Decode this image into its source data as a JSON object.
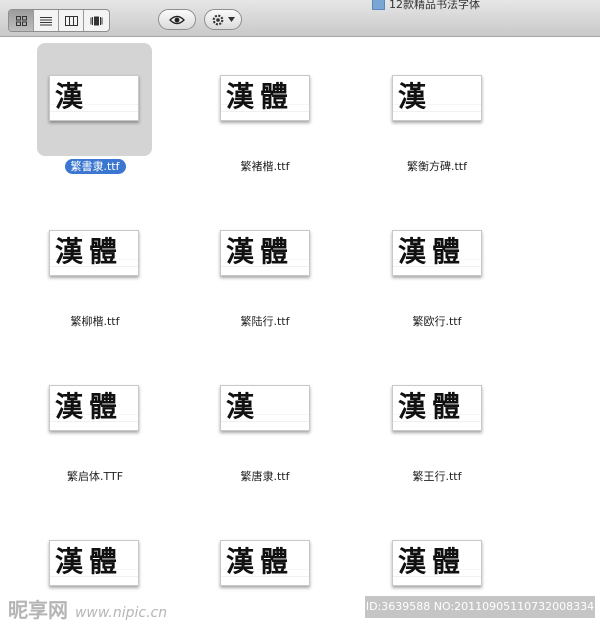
{
  "toolbar": {
    "view_modes": [
      {
        "name": "icon-view",
        "icon": "grid-icon",
        "active": true
      },
      {
        "name": "list-view",
        "icon": "list-icon",
        "active": false
      },
      {
        "name": "column-view",
        "icon": "columns-icon",
        "active": false
      },
      {
        "name": "coverflow-view",
        "icon": "coverflow-icon",
        "active": false
      }
    ],
    "quicklook_icon": "eye-icon",
    "action_icon": "gear-icon",
    "path_label": "12款精品书法字体"
  },
  "files": [
    {
      "glyphs": "漢",
      "label": "繁書隶.ttf",
      "selected": true
    },
    {
      "glyphs": "漢體",
      "label": "繁褚楷.ttf",
      "selected": false
    },
    {
      "glyphs": "漢",
      "label": "繁衡方碑.ttf",
      "selected": false
    },
    {
      "glyphs": "漢體",
      "label": "繁柳楷.ttf",
      "selected": false
    },
    {
      "glyphs": "漢體",
      "label": "繁陆行.ttf",
      "selected": false
    },
    {
      "glyphs": "漢體",
      "label": "繁欧行.ttf",
      "selected": false
    },
    {
      "glyphs": "漢體",
      "label": "繁启体.TTF",
      "selected": false
    },
    {
      "glyphs": "漢",
      "label": "繁唐隶.ttf",
      "selected": false
    },
    {
      "glyphs": "漢體",
      "label": "繁王行.ttf",
      "selected": false
    },
    {
      "glyphs": "漢體",
      "label": "",
      "selected": false
    },
    {
      "glyphs": "漢體",
      "label": "",
      "selected": false
    },
    {
      "glyphs": "漢體",
      "label": "",
      "selected": false
    }
  ],
  "watermark": {
    "left": "昵享网",
    "left_url": "www.nipic.cn",
    "right": "ID:3639588 NO:20110905110732008334"
  }
}
